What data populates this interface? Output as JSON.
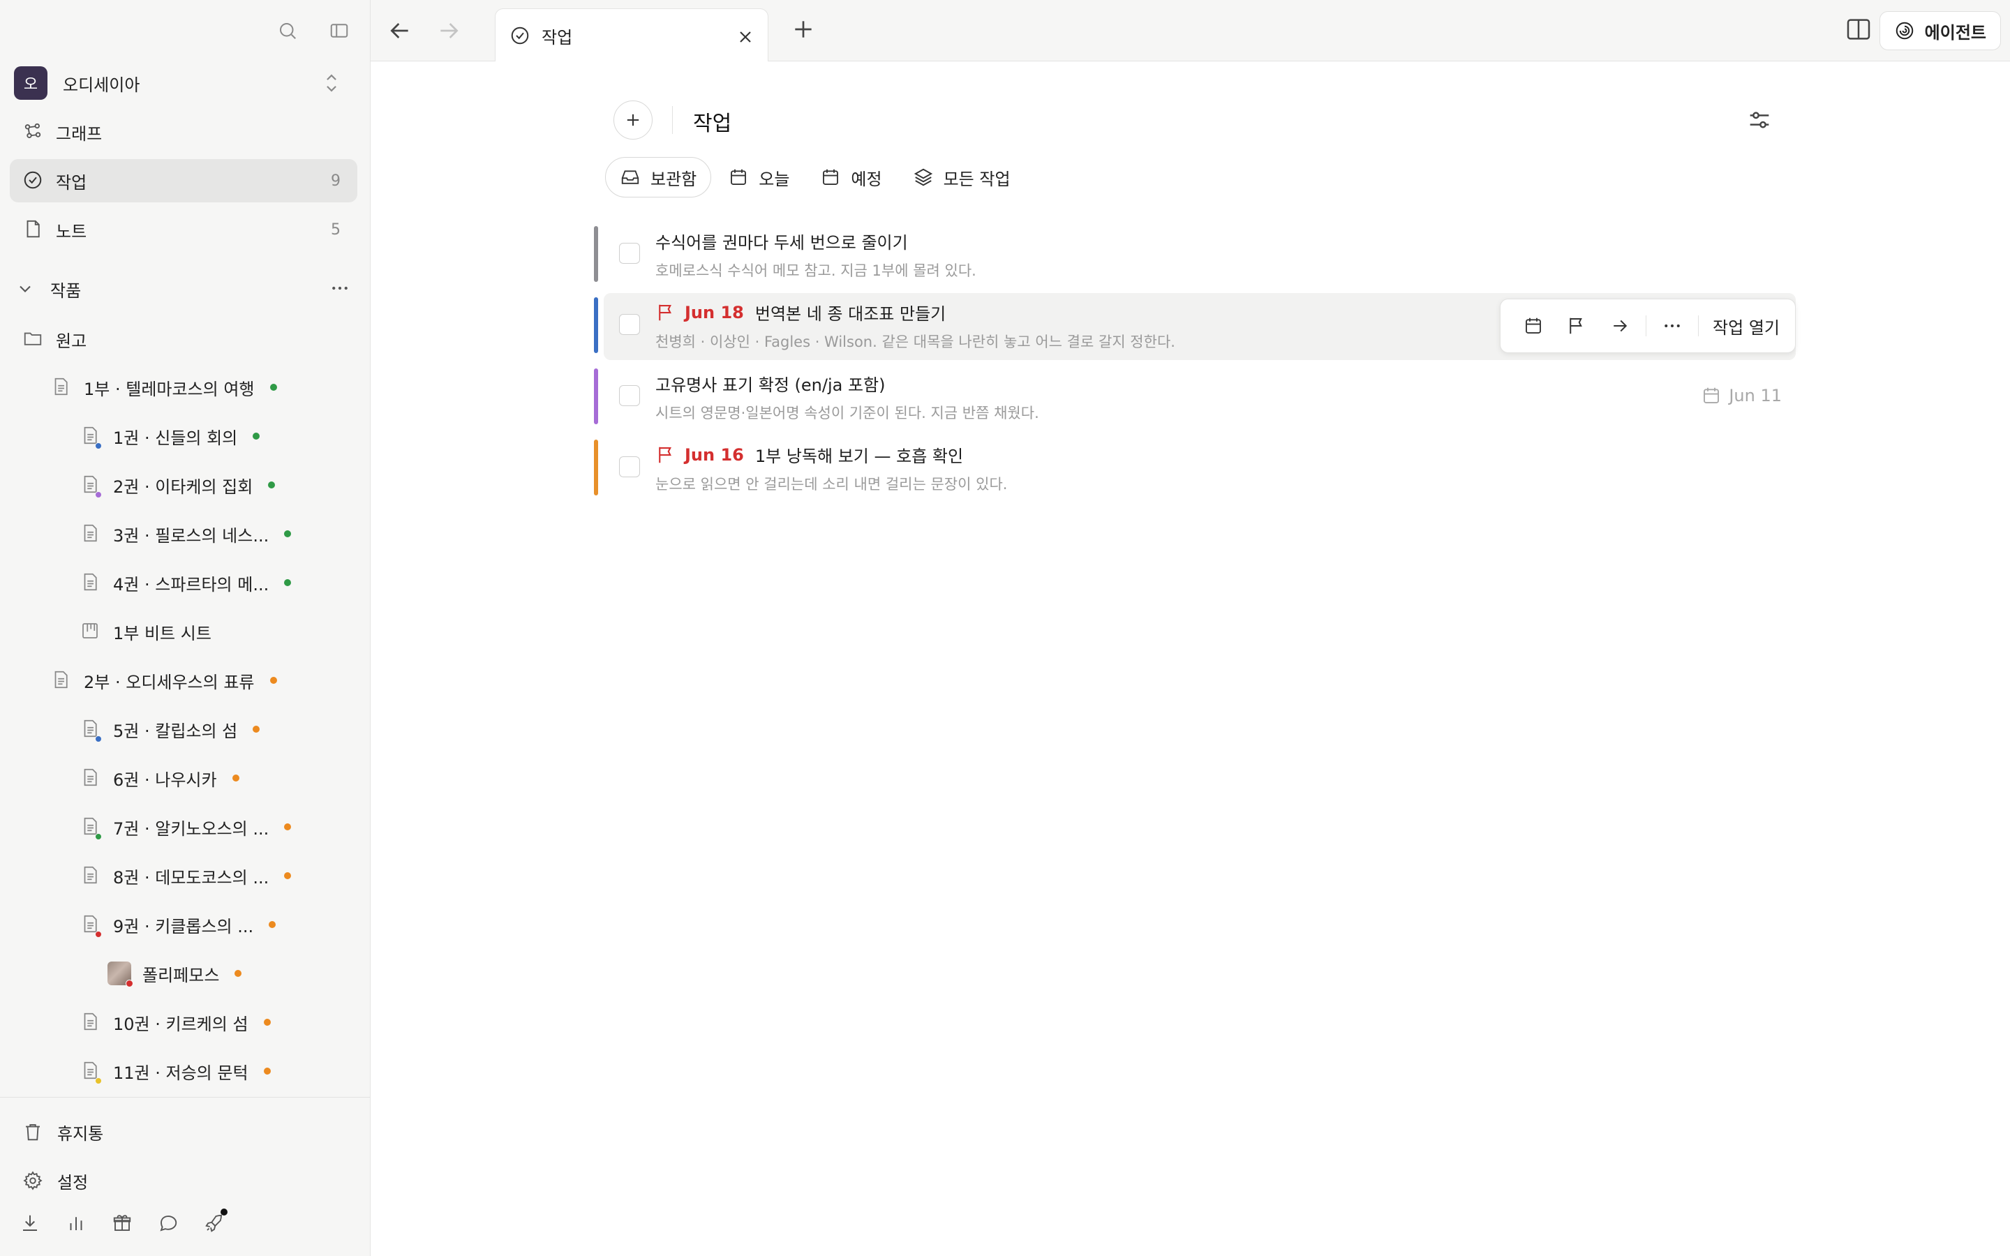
{
  "colors": {
    "accent_red": "#d42f2f",
    "bar_gray": "#8e8e93",
    "bar_blue": "#3a6fc4",
    "bar_purple": "#a66cd6",
    "bar_orange": "#e8902a",
    "dot_green": "#2f9a46",
    "dot_orange": "#ec8a1f",
    "dot_blue": "#3a6fc4",
    "dot_purple": "#a66cd6",
    "dot_red": "#d42f2f",
    "dot_yellow": "#e8c22a"
  },
  "sidebar": {
    "workspace": {
      "initial": "오",
      "name": "오디세이아"
    },
    "nav": [
      {
        "label": "그래프",
        "icon": "graph-icon",
        "count": ""
      },
      {
        "label": "작업",
        "icon": "task-check-icon",
        "count": "9"
      },
      {
        "label": "노트",
        "icon": "note-icon",
        "count": "5"
      }
    ],
    "section": {
      "label": "작품"
    },
    "tree": [
      {
        "label": "원고",
        "icon": "folder-icon"
      },
      {
        "label": "1부 · 텔레마코스의 여행",
        "icon": "document-icon"
      },
      {
        "label": "1권 · 신들의 회의",
        "icon": "document-icon"
      },
      {
        "label": "2권 · 이타케의 집회",
        "icon": "document-icon"
      },
      {
        "label": "3권 · 필로스의 네스...",
        "icon": "document-icon"
      },
      {
        "label": "4권 · 스파르타의 메...",
        "icon": "document-icon"
      },
      {
        "label": "1부 비트 시트",
        "icon": "board-icon"
      },
      {
        "label": "2부 · 오디세우스의 표류",
        "icon": "document-icon"
      },
      {
        "label": "5권 · 칼립소의 섬",
        "icon": "document-icon"
      },
      {
        "label": "6권 · 나우시카",
        "icon": "document-icon"
      },
      {
        "label": "7권 · 알키노오스의 ...",
        "icon": "document-icon"
      },
      {
        "label": "8권 · 데모도코스의 ...",
        "icon": "document-icon"
      },
      {
        "label": "9권 · 키클롭스의 ...",
        "icon": "document-icon"
      },
      {
        "label": "폴리페모스",
        "icon": "image-thumbnail"
      },
      {
        "label": "10권 · 키르케의 섬",
        "icon": "document-icon"
      },
      {
        "label": "11권 · 저승의 문턱",
        "icon": "document-icon"
      }
    ],
    "bottom": [
      {
        "label": "휴지통",
        "icon": "trash-icon"
      },
      {
        "label": "설정",
        "icon": "gear-icon"
      }
    ],
    "tools": [
      "download-icon",
      "chart-icon",
      "gift-icon",
      "chat-icon",
      "rocket-icon"
    ]
  },
  "tabbar": {
    "tab_title": "작업",
    "agent_label": "에이전트"
  },
  "main": {
    "title": "작업",
    "views": [
      {
        "label": "보관함",
        "icon": "inbox-icon"
      },
      {
        "label": "오늘",
        "icon": "calendar-icon"
      },
      {
        "label": "예정",
        "icon": "calendar-icon"
      },
      {
        "label": "모든 작업",
        "icon": "layers-icon"
      }
    ],
    "tasks": [
      {
        "title": "수식어를 권마다 두세 번으로 줄이기",
        "note": "호메로스식 수식어 메모 참고. 지금 1부에 몰려 있다.",
        "due": "",
        "date": ""
      },
      {
        "title": "번역본 네 종 대조표 만들기",
        "note": "천병희 · 이상인 · Fagles · Wilson. 같은 대목을 나란히 놓고 어느 결로 갈지 정한다.",
        "due": "Jun 18",
        "date": ""
      },
      {
        "title": "고유명사 표기 확정 (en/ja 포함)",
        "note": "시트의 영문명·일본어명 속성이 기준이 된다. 지금 반쯤 채웠다.",
        "due": "",
        "date": "Jun 11"
      },
      {
        "title": "1부 낭독해 보기 — 호흡 확인",
        "note": "눈으로 읽으면 안 걸리는데 소리 내면 걸리는 문장이 있다.",
        "due": "Jun 16",
        "date": ""
      }
    ],
    "task_toolbar": {
      "open_label": "작업 열기"
    }
  }
}
